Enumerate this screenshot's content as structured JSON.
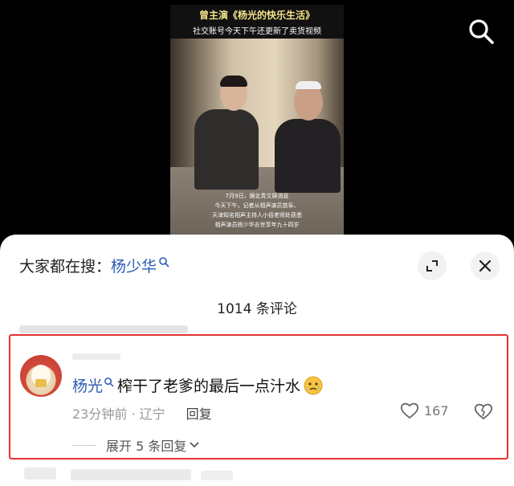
{
  "video": {
    "caption_top_line1": "曾主演《杨光的快乐生活》",
    "caption_top_line2": "社交账号今天下午还更新了卖货视频",
    "caption_bottom": [
      "7月9日，据北青文娱消息",
      "今天下午，记者从相声演员苗阜、",
      "天津知名相声主持人小佰老师处获悉",
      "相声演员杨少华去世享年九十四岁"
    ]
  },
  "search_bar": {
    "prefix": "大家都在搜：",
    "term": "杨少华"
  },
  "comment_count_label": "1014 条评论",
  "comment": {
    "author": "杨光",
    "text": "榨干了老爹的最后一点汁水",
    "emoji": "crying-face-emoji",
    "time_location": "23分钟前 · 辽宁",
    "reply_label": "回复",
    "like_count": "167",
    "expand_replies_label": "展开 5 条回复"
  },
  "icons": {
    "top_search": "search-icon",
    "expand": "expand-icon",
    "close": "close-icon",
    "like": "heart-icon",
    "dislike": "broken-heart-icon"
  },
  "colors": {
    "link_blue": "#2a5bb4",
    "highlight_red": "#e23333"
  }
}
